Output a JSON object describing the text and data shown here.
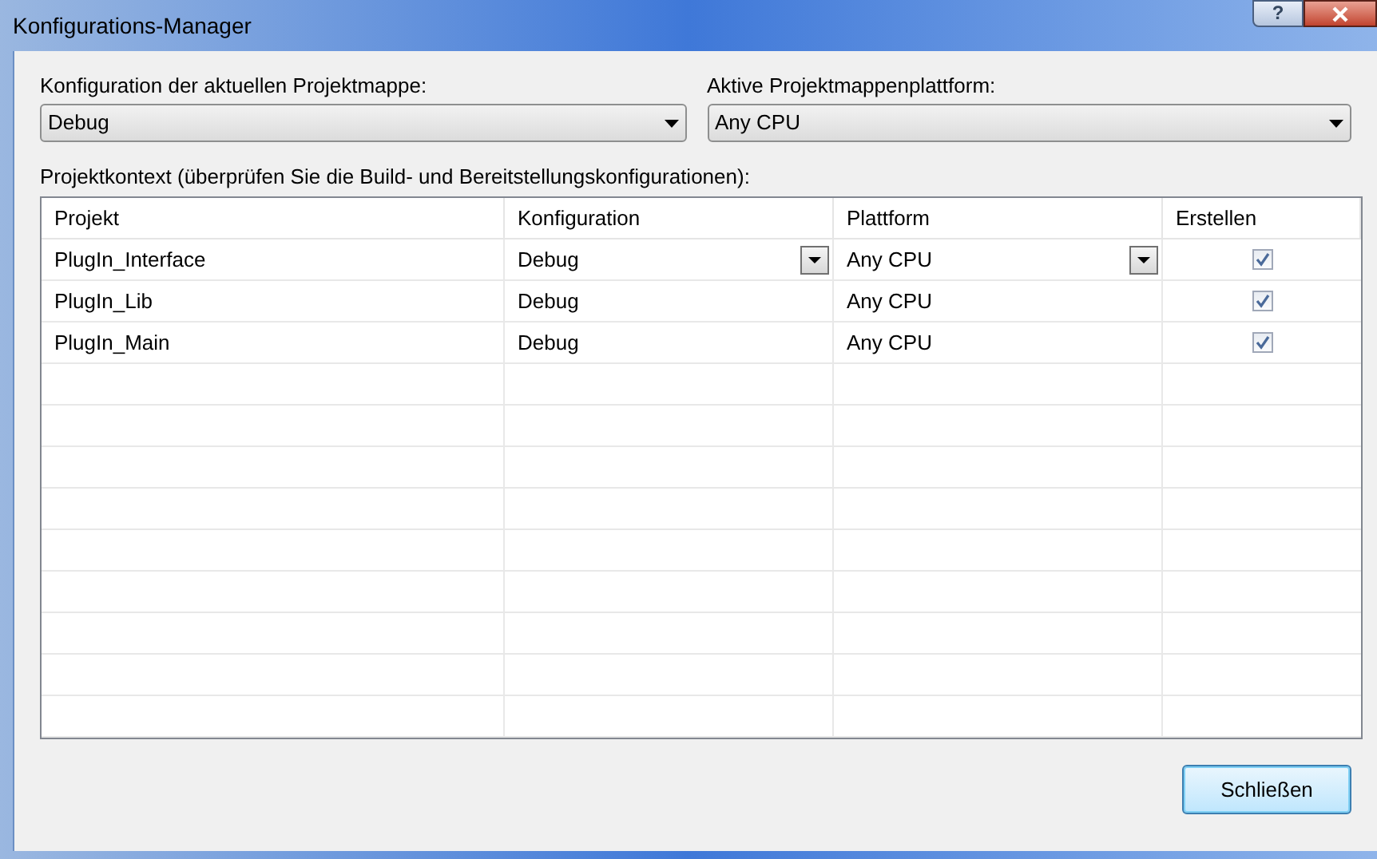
{
  "window": {
    "title": "Konfigurations-Manager",
    "help_button": "?"
  },
  "solution_configuration": {
    "label": "Konfiguration der aktuellen Projektmappe:",
    "value": "Debug"
  },
  "solution_platform": {
    "label": "Aktive Projektmappenplattform:",
    "value": "Any CPU"
  },
  "project_context_label": "Projektkontext (überprüfen Sie die Build- und Bereitstellungskonfigurationen):",
  "table": {
    "columns": [
      "Projekt",
      "Konfiguration",
      "Plattform",
      "Erstellen"
    ],
    "rows": [
      {
        "project": "PlugIn_Interface",
        "configuration": "Debug",
        "platform": "Any CPU",
        "build": true,
        "editing": true
      },
      {
        "project": "PlugIn_Lib",
        "configuration": "Debug",
        "platform": "Any CPU",
        "build": true,
        "editing": false
      },
      {
        "project": "PlugIn_Main",
        "configuration": "Debug",
        "platform": "Any CPU",
        "build": true,
        "editing": false
      }
    ]
  },
  "buttons": [
    "Schließen"
  ]
}
